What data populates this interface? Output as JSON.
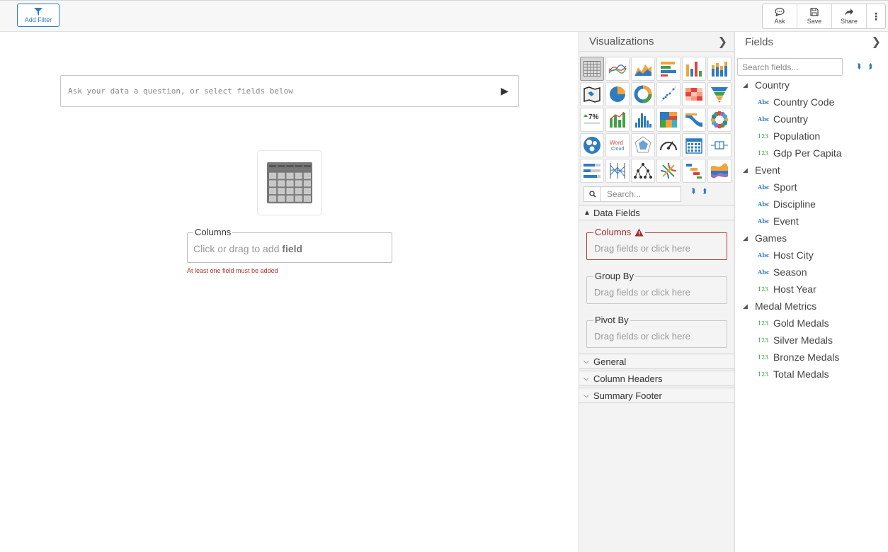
{
  "toolbar": {
    "add_filter_label": "Add Filter",
    "ask_label": "Ask",
    "save_label": "Save",
    "share_label": "Share"
  },
  "canvas": {
    "ask_placeholder": "Ask your data a question, or select fields below",
    "columns_legend": "Columns",
    "columns_placeholder_prefix": "Click or drag to add ",
    "columns_placeholder_bold": "field",
    "columns_error": "At least one field must be added"
  },
  "visualizations": {
    "title": "Visualizations",
    "search_placeholder": "Search...",
    "selected_index": 0,
    "tiles": [
      "table-icon",
      "line-chart-icon",
      "area-chart-icon",
      "bar-chart-icon",
      "column-chart-icon",
      "stacked-column-icon",
      "map-icon",
      "pie-chart-icon",
      "donut-chart-icon",
      "scatter-chart-icon",
      "heatmap-icon",
      "funnel-chart-icon",
      "kpi-icon",
      "combo-chart-icon",
      "histogram-icon",
      "treemap-icon",
      "sankey-icon",
      "sunburst-icon",
      "bubble-pack-icon",
      "word-cloud-icon",
      "radar-chart-icon",
      "gauge-icon",
      "calendar-icon",
      "box-plot-icon",
      "progress-bar-icon",
      "parallel-coords-icon",
      "tree-diagram-icon",
      "chord-icon",
      "gantt-icon",
      "streamgraph-icon"
    ],
    "kpi_text": "7%",
    "word_cloud_text": "Word Cloud",
    "data_fields_label": "Data Fields",
    "wells": [
      {
        "label": "Columns",
        "placeholder": "Drag fields or click here",
        "error": true
      },
      {
        "label": "Group By",
        "placeholder": "Drag fields or click here",
        "error": false
      },
      {
        "label": "Pivot By",
        "placeholder": "Drag fields or click here",
        "error": false
      }
    ],
    "sections": [
      "General",
      "Column Headers",
      "Summary Footer"
    ]
  },
  "fields": {
    "title": "Fields",
    "search_placeholder": "Search fields...",
    "groups": [
      {
        "name": "Country",
        "items": [
          {
            "type": "Abc",
            "name": "Country Code"
          },
          {
            "type": "Abc",
            "name": "Country"
          },
          {
            "type": "123",
            "name": "Population"
          },
          {
            "type": "123",
            "name": "Gdp Per Capita"
          }
        ]
      },
      {
        "name": "Event",
        "items": [
          {
            "type": "Abc",
            "name": "Sport"
          },
          {
            "type": "Abc",
            "name": "Discipline"
          },
          {
            "type": "Abc",
            "name": "Event"
          }
        ]
      },
      {
        "name": "Games",
        "items": [
          {
            "type": "Abc",
            "name": "Host City"
          },
          {
            "type": "Abc",
            "name": "Season"
          },
          {
            "type": "123",
            "name": "Host Year"
          }
        ]
      },
      {
        "name": "Medal Metrics",
        "items": [
          {
            "type": "123",
            "name": "Gold Medals"
          },
          {
            "type": "123",
            "name": "Silver Medals"
          },
          {
            "type": "123",
            "name": "Bronze Medals"
          },
          {
            "type": "123",
            "name": "Total Medals"
          }
        ]
      }
    ]
  }
}
